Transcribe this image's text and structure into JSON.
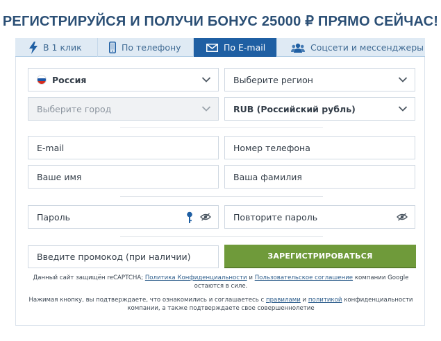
{
  "title": "РЕГИСТРИРУЙСЯ И ПОЛУЧИ БОНУС 25000 ₽ ПРЯМО СЕЙЧАС!",
  "tabs": [
    {
      "label": "В 1 клик",
      "icon": "lightning-icon",
      "active": false
    },
    {
      "label": "По телефону",
      "icon": "phone-icon",
      "active": false
    },
    {
      "label": "По E-mail",
      "icon": "envelope-icon",
      "active": true
    },
    {
      "label": "Соцсети и мессенджеры",
      "icon": "users-icon",
      "active": false
    }
  ],
  "form": {
    "country": "Россия",
    "region_placeholder": "Выберите регион",
    "city_placeholder": "Выберите город",
    "currency": "RUB (Российский рубль)",
    "email_placeholder": "E-mail",
    "phone_placeholder": "Номер телефона",
    "firstname_placeholder": "Ваше имя",
    "lastname_placeholder": "Ваша фамилия",
    "password_placeholder": "Пароль",
    "password_repeat_placeholder": "Повторите пароль",
    "promo_placeholder": "Введите промокод (при наличии)",
    "register_label": "ЗАРЕГИСТРИРОВАТЬСЯ"
  },
  "recaptcha": {
    "text_1": "Данный сайт защищён reCAPTCHA;",
    "link_privacy": "Политика Конфиденциальности",
    "and": "и",
    "link_terms": "Пользовательское соглашение",
    "text_2": "компании Google",
    "text_3": "остаются в силе."
  },
  "consent": {
    "text_1": "Нажимая кнопку, вы подтверждаете, что ознакомились и соглашаетесь с",
    "link_rules": "правилами",
    "and": "и",
    "link_policy": "политикой",
    "text_2": "конфиденциальности",
    "text_3": "компании, а также подтверждаете свое совершеннолетие"
  },
  "colors": {
    "title": "#2b4f75",
    "tab_active": "#1f5fa3",
    "tab_bg": "#dfeaf4",
    "register_button": "#6f9a3a",
    "link": "#2f5f8d"
  }
}
